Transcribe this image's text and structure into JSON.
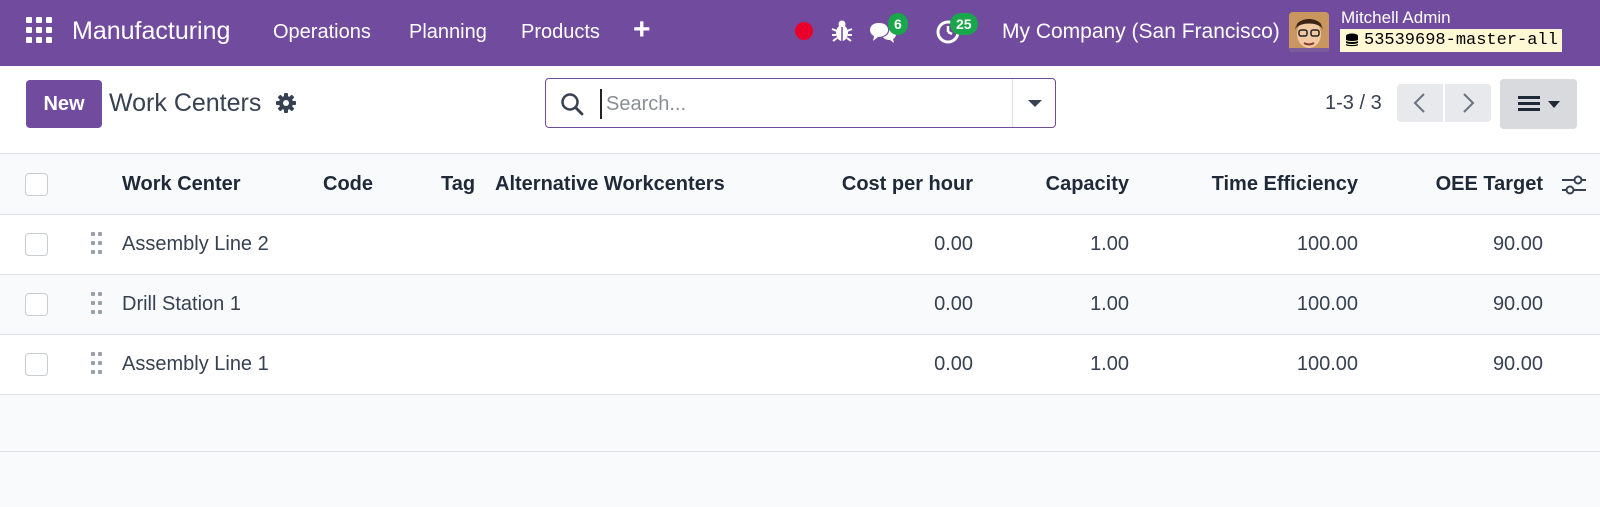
{
  "navbar": {
    "app_name": "Manufacturing",
    "menus": [
      "Operations",
      "Planning",
      "Products"
    ],
    "plus": "+",
    "chat_count": "6",
    "activity_count": "25",
    "company": "My Company (San Francisco)",
    "user_name": "Mitchell Admin",
    "database": "53539698-master-all",
    "colors": {
      "bar": "#714b9e",
      "badge": "#1aa64a",
      "record": "#e8002a"
    },
    "icons": [
      "apps-grid-icon",
      "record-dot-icon",
      "bug-icon",
      "chat-icon",
      "clock-icon",
      "database-icon"
    ]
  },
  "control_panel": {
    "new_label": "New",
    "title": "Work Centers",
    "search_placeholder": "Search...",
    "pager": "1-3 / 3"
  },
  "table": {
    "columns": [
      "Work Center",
      "Code",
      "Tag",
      "Alternative Workcenters",
      "Cost per hour",
      "Capacity",
      "Time Efficiency",
      "OEE Target"
    ],
    "rows": [
      {
        "work_center": "Assembly Line 2",
        "code": "",
        "tag": "",
        "alternatives": "",
        "cost": "0.00",
        "capacity": "1.00",
        "efficiency": "100.00",
        "oee": "90.00"
      },
      {
        "work_center": "Drill Station 1",
        "code": "",
        "tag": "",
        "alternatives": "",
        "cost": "0.00",
        "capacity": "1.00",
        "efficiency": "100.00",
        "oee": "90.00"
      },
      {
        "work_center": "Assembly Line 1",
        "code": "",
        "tag": "",
        "alternatives": "",
        "cost": "0.00",
        "capacity": "1.00",
        "efficiency": "100.00",
        "oee": "90.00"
      }
    ]
  }
}
